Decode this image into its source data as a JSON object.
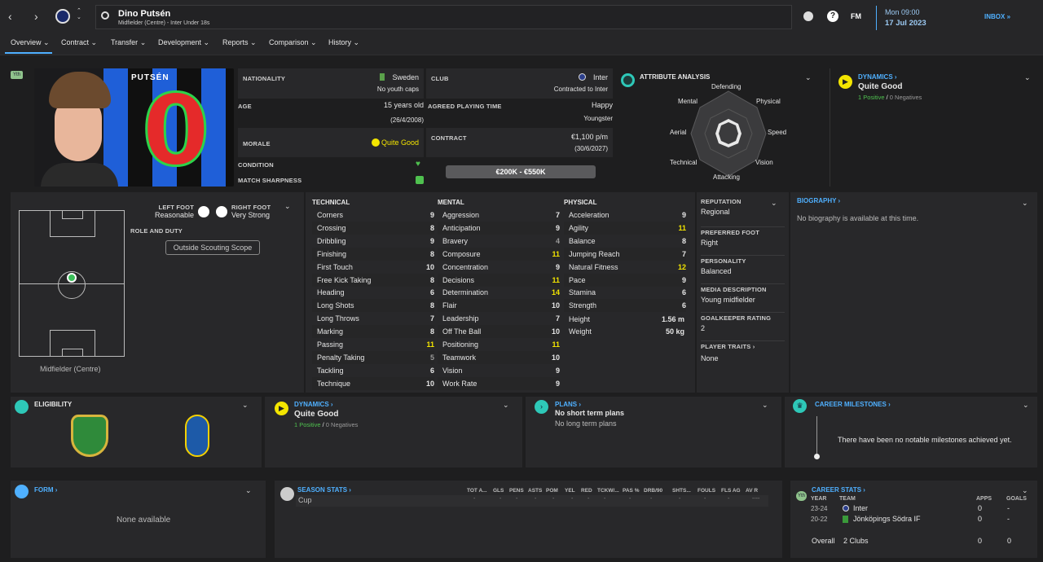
{
  "header": {
    "name": "Dino Putsén",
    "subtitle": "Midfielder (Centre) - Inter Under 18s",
    "fm_label": "FM",
    "day_time": "Mon 09:00",
    "date": "17 Jul 2023",
    "inbox": "INBOX"
  },
  "nav": [
    "Overview",
    "Contract",
    "Transfer",
    "Development",
    "Reports",
    "Comparison",
    "History"
  ],
  "player_card": {
    "badge": "Yth",
    "shirt_name": "PUTSÉN",
    "shirt_number": "0"
  },
  "info": {
    "nationality_label": "NATIONALITY",
    "nationality": "Sweden",
    "youth_caps": "No youth caps",
    "club_label": "CLUB",
    "club": "Inter",
    "club_status": "Contracted to Inter",
    "age_label": "AGE",
    "age": "15 years old",
    "dob": "(26/4/2008)",
    "playing_time_label": "AGREED PLAYING TIME",
    "playing_time_mood": "Happy",
    "playing_time": "Youngster",
    "morale_label": "MORALE",
    "morale": "Quite Good",
    "contract_label": "CONTRACT",
    "wage": "€1,100 p/m",
    "contract_end": "(30/6/2027)",
    "condition_label": "CONDITION",
    "sharpness_label": "MATCH SHARPNESS",
    "value_range": "€200K - €550K"
  },
  "analysis": {
    "title": "ATTRIBUTE ANALYSIS",
    "labels": {
      "defending": "Defending",
      "physical": "Physical",
      "speed": "Speed",
      "vision": "Vision",
      "attacking": "Attacking",
      "technical": "Technical",
      "aerial": "Aerial",
      "mental": "Mental"
    }
  },
  "dynamics_top": {
    "title": "DYNAMICS",
    "value": "Quite Good",
    "positives": "1 Positive",
    "negatives": "0 Negatives"
  },
  "pitch": {
    "left_foot_label": "LEFT FOOT",
    "left_foot": "Reasonable",
    "right_foot_label": "RIGHT FOOT",
    "right_foot": "Very Strong",
    "role_label": "ROLE AND DUTY",
    "scouting": "Outside Scouting Scope",
    "position": "Midfielder (Centre)"
  },
  "technical": {
    "title": "TECHNICAL",
    "rows": [
      [
        "Corners",
        "9"
      ],
      [
        "Crossing",
        "8"
      ],
      [
        "Dribbling",
        "9"
      ],
      [
        "Finishing",
        "8"
      ],
      [
        "First Touch",
        "10"
      ],
      [
        "Free Kick Taking",
        "8"
      ],
      [
        "Heading",
        "6"
      ],
      [
        "Long Shots",
        "8"
      ],
      [
        "Long Throws",
        "7"
      ],
      [
        "Marking",
        "8"
      ],
      [
        "Passing",
        "11"
      ],
      [
        "Penalty Taking",
        "5"
      ],
      [
        "Tackling",
        "6"
      ],
      [
        "Technique",
        "10"
      ]
    ]
  },
  "mental": {
    "title": "MENTAL",
    "rows": [
      [
        "Aggression",
        "7"
      ],
      [
        "Anticipation",
        "9"
      ],
      [
        "Bravery",
        "4"
      ],
      [
        "Composure",
        "11"
      ],
      [
        "Concentration",
        "9"
      ],
      [
        "Decisions",
        "11"
      ],
      [
        "Determination",
        "14"
      ],
      [
        "Flair",
        "10"
      ],
      [
        "Leadership",
        "7"
      ],
      [
        "Off The Ball",
        "10"
      ],
      [
        "Positioning",
        "11"
      ],
      [
        "Teamwork",
        "10"
      ],
      [
        "Vision",
        "9"
      ],
      [
        "Work Rate",
        "9"
      ]
    ]
  },
  "physical": {
    "title": "PHYSICAL",
    "rows": [
      [
        "Acceleration",
        "9"
      ],
      [
        "Agility",
        "11"
      ],
      [
        "Balance",
        "8"
      ],
      [
        "Jumping Reach",
        "7"
      ],
      [
        "Natural Fitness",
        "12"
      ],
      [
        "Pace",
        "9"
      ],
      [
        "Stamina",
        "6"
      ],
      [
        "Strength",
        "6"
      ]
    ],
    "height_label": "Height",
    "height": "1.56 m",
    "weight_label": "Weight",
    "weight": "50 kg"
  },
  "profile": {
    "reputation_label": "REPUTATION",
    "reputation": "Regional",
    "foot_label": "PREFERRED FOOT",
    "foot": "Right",
    "personality_label": "PERSONALITY",
    "personality": "Balanced",
    "media_label": "MEDIA DESCRIPTION",
    "media": "Young midfielder",
    "gk_label": "GOALKEEPER RATING",
    "gk": "2",
    "traits_label": "PLAYER TRAITS",
    "traits": "None"
  },
  "biography": {
    "title": "BIOGRAPHY",
    "text": "No biography is available at this time."
  },
  "eligibility": {
    "title": "ELIGIBILITY"
  },
  "dynamics_bottom": {
    "title": "DYNAMICS",
    "value": "Quite Good",
    "positives": "1 Positive",
    "negatives": "0 Negatives"
  },
  "plans": {
    "title": "PLANS",
    "short": "No short term plans",
    "long": "No long term plans"
  },
  "milestones": {
    "title": "CAREER MILESTONES",
    "text": "There have been no notable milestones achieved yet."
  },
  "form": {
    "title": "FORM",
    "text": "None available"
  },
  "season_stats": {
    "title": "SEASON STATS",
    "headers": [
      "TOT A...",
      "GLS",
      "PENS",
      "ASTS",
      "POM",
      "YEL",
      "RED",
      "TCKW/...",
      "PAS %",
      "DRB/90",
      "SHTS...",
      "FOULS",
      "FLS AG",
      "AV R"
    ],
    "row_label": "Cup",
    "row": [
      "-",
      "-",
      "-",
      "-",
      "-",
      "-",
      "-",
      "-",
      "-",
      "-",
      "-",
      "-",
      "-",
      "----"
    ]
  },
  "career_stats": {
    "title": "CAREER STATS",
    "badge": "Yth",
    "col_year": "YEAR",
    "col_team": "TEAM",
    "col_apps": "APPS",
    "col_goals": "GOALS",
    "rows": [
      {
        "year": "23-24",
        "team": "Inter",
        "apps": "0",
        "goals": "-"
      },
      {
        "year": "20-22",
        "team": "Jönköpings Södra IF",
        "apps": "0",
        "goals": "-"
      }
    ],
    "overall_label": "Overall",
    "overall_clubs": "2 Clubs",
    "overall_apps": "0",
    "overall_goals": "0"
  },
  "colors": {
    "accent": "#4fb0ff",
    "positive": "#4fc14f",
    "highlight": "#f3e500",
    "dynamics": "#f3e500"
  }
}
